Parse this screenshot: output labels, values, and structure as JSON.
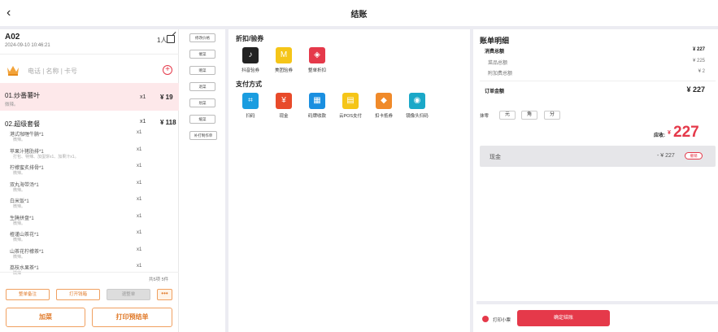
{
  "header": {
    "title": "结账",
    "back_icon": "chevron-left-icon"
  },
  "order": {
    "table_no": "A02",
    "time": "2024-09-10 10:46:21",
    "people": "1人",
    "member_placeholder": "电话 | 名称 | 卡号"
  },
  "items": [
    {
      "name": "01.炒番薯叶",
      "note": "微辣。",
      "qty": "x1",
      "price": "¥ 19"
    },
    {
      "name": "02.超级套餐",
      "qty": "x1",
      "price": "¥ 118"
    }
  ],
  "sub_items": [
    {
      "name": "港式咖喱牛腩*1",
      "note": "微辣。",
      "qty": "x1"
    },
    {
      "name": "苹果汁猪肋排*1",
      "note": "打包、特辣、加蛋饼x1、加果汁x1。",
      "qty": "x1"
    },
    {
      "name": "柠檬蜜炙排骨*1",
      "note": "微辣。",
      "qty": "x1"
    },
    {
      "name": "双丸海带汤*1",
      "note": "微辣。",
      "qty": "x1"
    },
    {
      "name": "白米饭*1",
      "note": "微辣。",
      "qty": "x1"
    },
    {
      "name": "生腌拼盘*1",
      "note": "微辣。",
      "qty": "x1"
    },
    {
      "name": "楂谨山茶花*1",
      "note": "微辣。",
      "qty": "x1"
    },
    {
      "name": "山茶花柠檬茶*1",
      "note": "微辣。",
      "qty": "x1"
    },
    {
      "name": "荔枝水果茶*1",
      "note": "微辣",
      "qty": "x1"
    }
  ],
  "summary": "共5项 5件",
  "left_buttons": {
    "order_note": "整单备注",
    "open_drawer": "打开钱箱",
    "cancel_dish": "退整单",
    "more": "•••",
    "add_dish": "加菜",
    "print_bill": "打印预结单"
  },
  "operations": [
    "修改价格",
    "催菜",
    "赠菜",
    "退菜",
    "划菜",
    "缓菜",
    "补打制作单"
  ],
  "discount": {
    "title": "折扣/验券",
    "items": [
      {
        "label": "抖音验券",
        "icon": "tiktok-icon",
        "color": "#222222"
      },
      {
        "label": "美团验券",
        "icon": "meituan-icon",
        "color": "#f5c518"
      },
      {
        "label": "整单折扣",
        "icon": "discount-tag-icon",
        "color": "#e5394a"
      }
    ]
  },
  "payment": {
    "title": "支付方式",
    "items": [
      {
        "label": "扫码",
        "icon": "scan-icon",
        "color": "#1a9de0"
      },
      {
        "label": "现金",
        "icon": "cash-icon",
        "color": "#e84a2a"
      },
      {
        "label": "码牌收款",
        "icon": "qr-board-icon",
        "color": "#1a8fe0"
      },
      {
        "label": "云POS支付",
        "icon": "pos-icon",
        "color": "#f5c518"
      },
      {
        "label": "扣卡抵券",
        "icon": "card-coupon-icon",
        "color": "#f08a2a"
      },
      {
        "label": "镜像头扫码",
        "icon": "camera-scan-icon",
        "color": "#1aa8c8"
      }
    ]
  },
  "bill": {
    "title": "账单明细",
    "consume_total_label": "消费总额",
    "consume_total": "¥ 227",
    "dish_total_label": "菜品总额",
    "dish_total": "¥ 225",
    "extra_total_label": "附加费总额",
    "extra_total": "¥ 2",
    "order_amount_label": "订单金额",
    "order_amount": "¥ 227",
    "rounding_label": "抹零",
    "rounding_options": [
      "元",
      "角",
      "分"
    ],
    "due_label": "应收:",
    "due_currency": "¥",
    "due_amount": "227",
    "cash_label": "现金",
    "cash_amount": "- ¥ 227",
    "cash_tag": "撤销"
  },
  "footer": {
    "print_receipt": "打印小票",
    "confirm": "确定结账"
  }
}
